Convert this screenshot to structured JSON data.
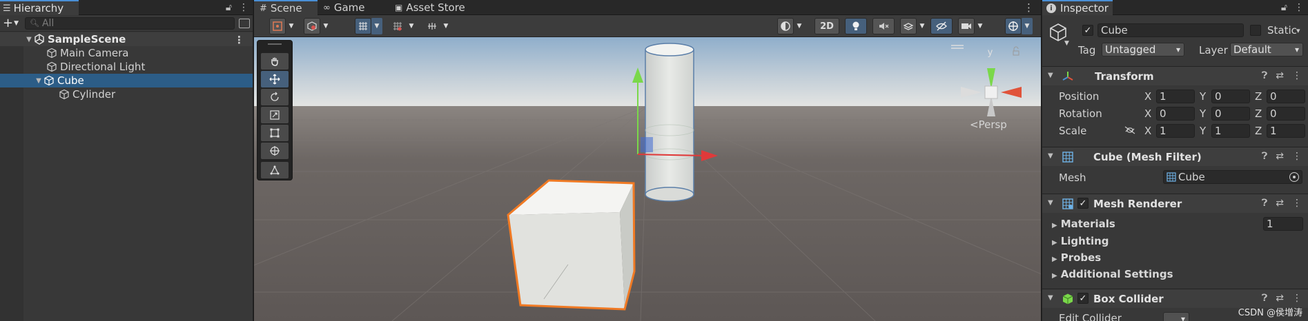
{
  "hierarchy": {
    "tab_label": "Hierarchy",
    "search_placeholder": "All",
    "add_label": "+",
    "items": [
      {
        "label": "SampleScene"
      },
      {
        "label": "Main Camera"
      },
      {
        "label": "Directional Light"
      },
      {
        "label": "Cube"
      },
      {
        "label": "Cylinder"
      }
    ]
  },
  "scene": {
    "tabs": [
      {
        "label": "Scene"
      },
      {
        "label": "Game"
      },
      {
        "label": "Asset Store"
      }
    ],
    "toolbar": {
      "mode_2d": "2D"
    },
    "persp_label": "Persp",
    "gizmo": {
      "y_axis": "y"
    }
  },
  "inspector": {
    "tab_label": "Inspector",
    "object_name": "Cube",
    "static_label": "Static",
    "tag_label": "Tag",
    "tag_value": "Untagged",
    "layer_label": "Layer",
    "layer_value": "Default",
    "transform": {
      "title": "Transform",
      "position_label": "Position",
      "rotation_label": "Rotation",
      "scale_label": "Scale",
      "axis_x": "X",
      "axis_y": "Y",
      "axis_z": "Z",
      "position": {
        "x": "1",
        "y": "0",
        "z": "0"
      },
      "rotation": {
        "x": "0",
        "y": "0",
        "z": "0"
      },
      "scale": {
        "x": "1",
        "y": "1",
        "z": "1"
      }
    },
    "mesh_filter": {
      "title": "Cube (Mesh Filter)",
      "mesh_label": "Mesh",
      "mesh_value": "Cube"
    },
    "mesh_renderer": {
      "title": "Mesh Renderer",
      "materials_label": "Materials",
      "materials_count": "1",
      "lighting_label": "Lighting",
      "probes_label": "Probes",
      "additional_label": "Additional Settings"
    },
    "box_collider": {
      "title": "Box Collider",
      "edit_collider_label": "Edit Collider"
    }
  },
  "watermark": "CSDN @侯增涛",
  "colors": {
    "selection": "#2c5d87",
    "accent": "#4a8fd6",
    "outline": "#f07a24"
  }
}
